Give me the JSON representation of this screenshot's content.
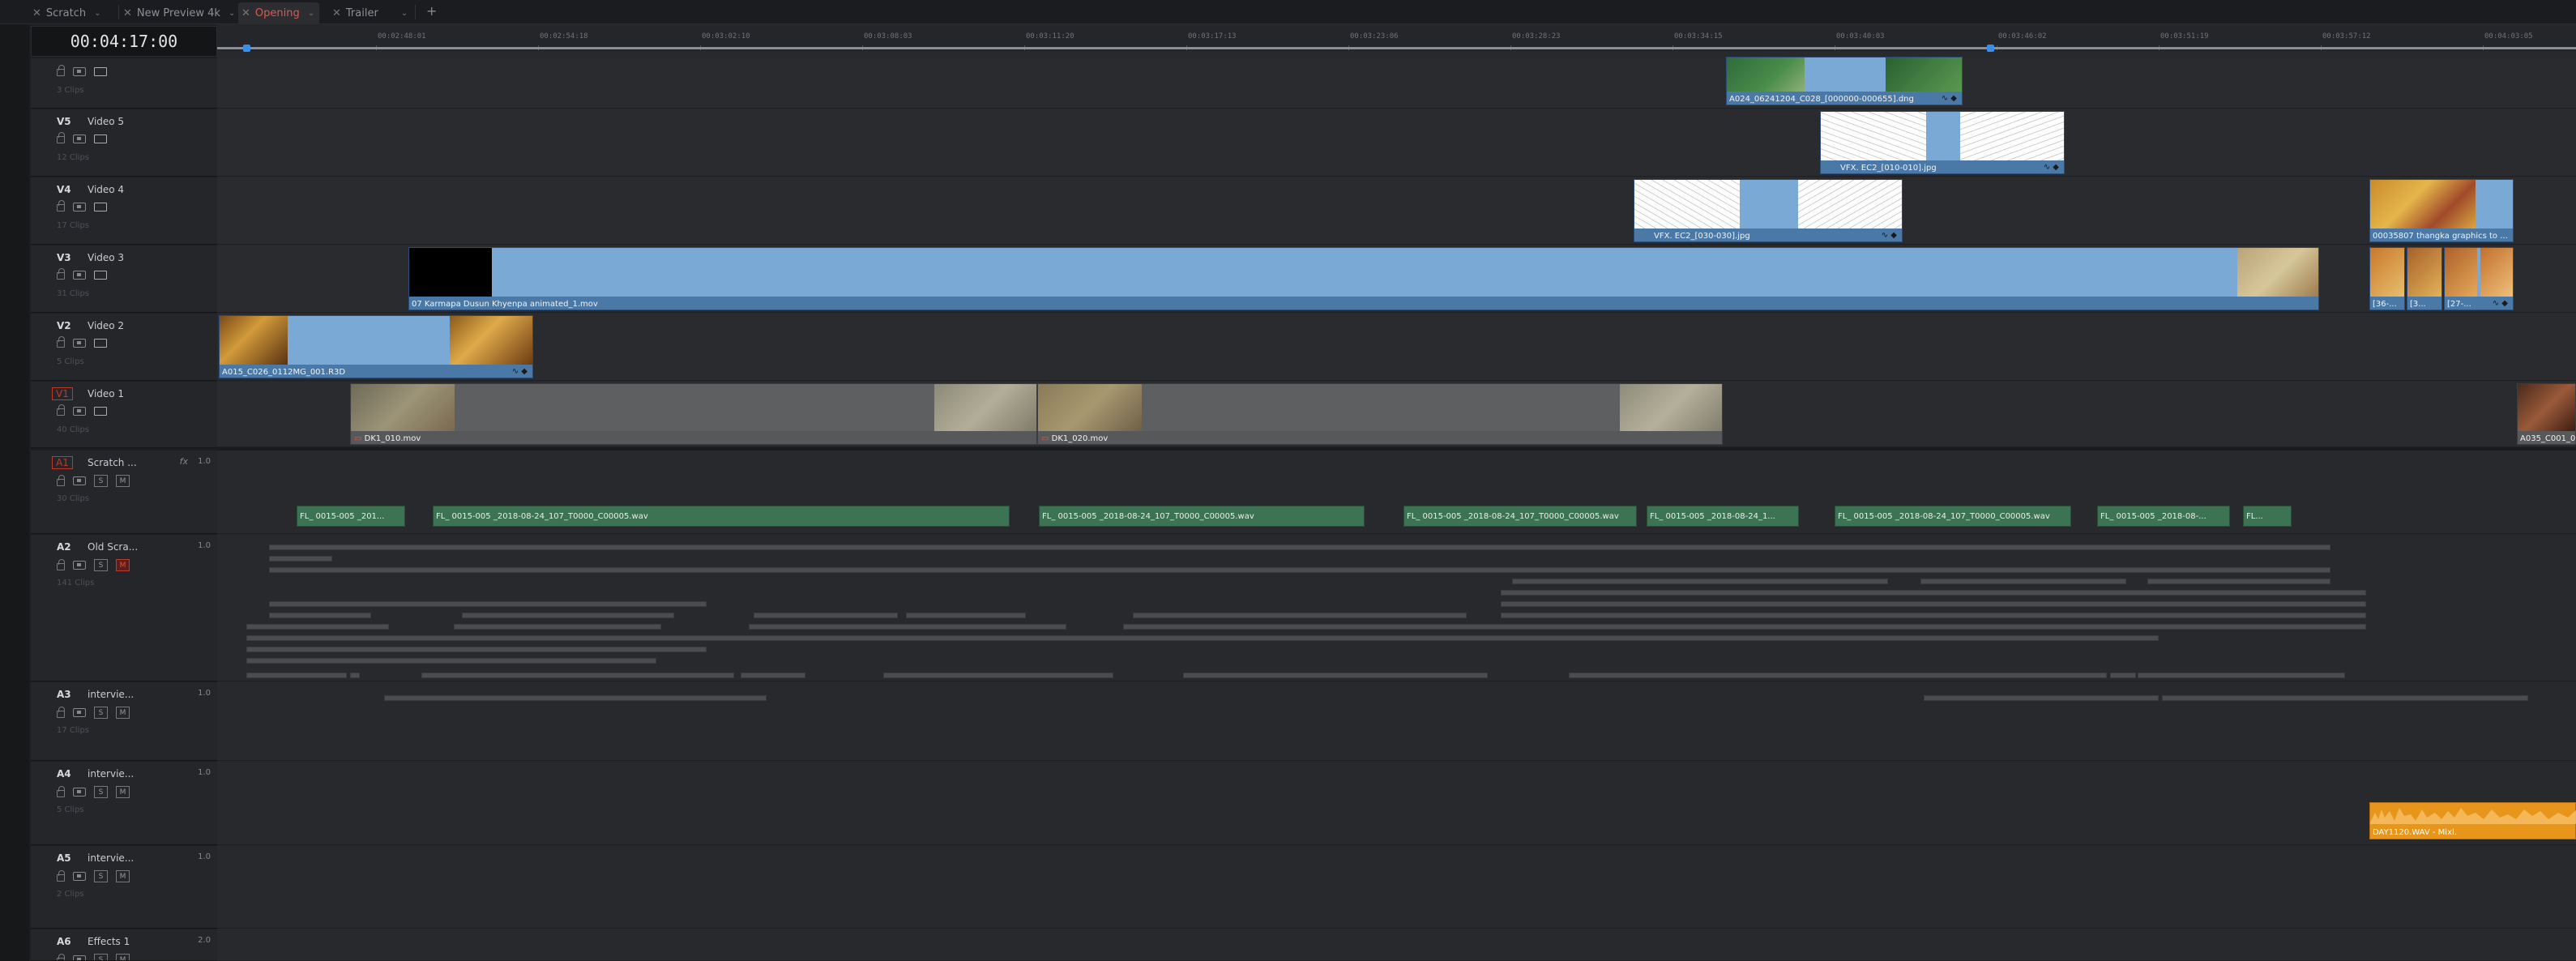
{
  "tabs": [
    {
      "label": "Scratch"
    },
    {
      "label": "New Preview 4k"
    },
    {
      "label": "Opening",
      "active": true
    },
    {
      "label": "Trailer"
    }
  ],
  "add_tab_label": "+",
  "timecode": "00:04:17:00",
  "ruler_ticks": [
    "00:02:48:01",
    "00:02:54:18",
    "00:03:02:10",
    "00:03:08:03",
    "00:03:11:20",
    "00:03:17:13",
    "00:03:23:06",
    "00:03:28:23",
    "00:03:34:15",
    "00:03:40:03",
    "00:03:46:02",
    "00:03:51:19",
    "00:03:57:12",
    "00:04:03:05"
  ],
  "tracks": {
    "v6": {
      "id": "",
      "name": "",
      "clips": "3 Clips"
    },
    "v5": {
      "id": "V5",
      "name": "Video 5",
      "clips": "12 Clips"
    },
    "v4": {
      "id": "V4",
      "name": "Video 4",
      "clips": "17 Clips"
    },
    "v3": {
      "id": "V3",
      "name": "Video 3",
      "clips": "31 Clips"
    },
    "v2": {
      "id": "V2",
      "name": "Video 2",
      "clips": "5 Clips"
    },
    "v1": {
      "id": "V1",
      "name": "Video 1",
      "clips": "40 Clips"
    },
    "a1": {
      "id": "A1",
      "name": "Scratch ...",
      "fx": "fx",
      "level": "1.0",
      "clips": "30 Clips"
    },
    "a2": {
      "id": "A2",
      "name": "Old Scra...",
      "level": "1.0",
      "clips": "141 Clips"
    },
    "a3": {
      "id": "A3",
      "name": "intervie...",
      "level": "1.0",
      "clips": "17 Clips"
    },
    "a4": {
      "id": "A4",
      "name": "intervie...",
      "level": "1.0",
      "clips": "5 Clips"
    },
    "a5": {
      "id": "A5",
      "name": "intervie...",
      "level": "1.0",
      "clips": "2 Clips"
    },
    "a6": {
      "id": "A6",
      "name": "Effects 1",
      "level": "2.0",
      "clips": ""
    }
  },
  "button_labels": {
    "solo": "S",
    "mute": "M"
  },
  "video_clips": {
    "v6_a024": "A024_06241204_C028_[000000-000655].dng",
    "v5_vfx": "VFX. EC2_[010-010].jpg",
    "v4_vfx": "VFX. EC2_[030-030].jpg",
    "v4_thangka": "00035807 thangka graphics to ...",
    "v3_karmapa": "07 Karmapa Dusun Khyenpa animated_1.mov",
    "v3_s1": "[36-...",
    "v3_s2": "[3...",
    "v3_s3": "[27-...",
    "v2_a015": "A015_C026_0112MG_001.R3D",
    "v1_dk1": "DK1_010.mov",
    "v1_dk2": "DK1_020.mov",
    "v1_a035": "A035_C001_0..."
  },
  "audio_clips": [
    "FL_ 0015-005 _201...",
    "FL_ 0015-005 _2018-08-24_107_T0000_C00005.wav",
    "FL_ 0015-005 _2018-08-24_107_T0000_C00005.wav",
    "FL_ 0015-005 _2018-08-24_107_T0000_C00005.wav",
    "FL_ 0015-005 _2018-08-24_1...",
    "FL_ 0015-005 _2018-08-24_107_T0000_C00005.wav",
    "FL_ 0015-005 _2018-08-...",
    "FL..."
  ],
  "orange_clip": "DAY1120.WAV - Mixl.",
  "colors": {
    "video_clip": "#7ba9d6",
    "audio_clip": "#3c7352",
    "orange_clip": "#e8951c",
    "active_tab": "#e0574e",
    "marker": "#3a8ee6"
  }
}
